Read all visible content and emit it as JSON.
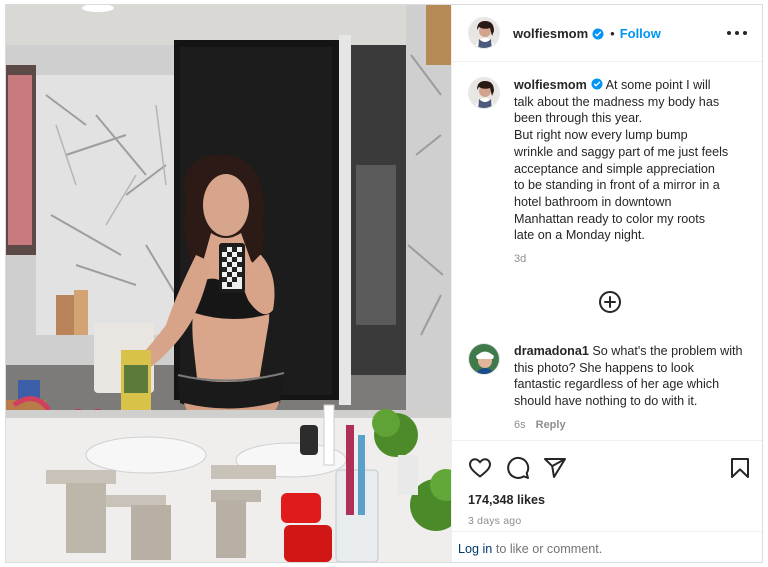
{
  "post": {
    "username": "wolfiesmom",
    "follow_label": "Follow",
    "separator": "•",
    "caption_lines": [
      "At some point I will",
      "talk about the madness my body has",
      "been through this year.",
      "But right now every lump bump",
      "wrinkle and saggy part of me just feels",
      "acceptance and simple appreciation",
      "to be standing in front of a mirror in a",
      "hotel bathroom in downtown",
      "Manhattan ready to color my roots",
      "late on a Monday night."
    ],
    "caption_time": "3d"
  },
  "comment": {
    "username": "dramadona1",
    "lines": [
      "So what's the problem with",
      "this photo? She happens to look",
      "fantastic regardless of her age which",
      "should have nothing to do with it."
    ],
    "time": "6s",
    "reply_label": "Reply"
  },
  "engagement": {
    "likes": "174,348 likes",
    "posted": "3 days ago"
  },
  "footer": {
    "login_link": "Log in",
    "login_suffix": " to like or comment."
  },
  "icons": {
    "verified": "verified-badge-icon",
    "more": "more-options-icon",
    "add_comments": "plus-circle-icon",
    "like": "heart-icon",
    "comment": "comment-bubble-icon",
    "share": "paper-plane-icon",
    "save": "bookmark-icon"
  },
  "colors": {
    "accent": "#0095f6",
    "verified": "#0095f6",
    "text": "#262626",
    "muted": "#8e8e8e",
    "link": "#00376b"
  }
}
